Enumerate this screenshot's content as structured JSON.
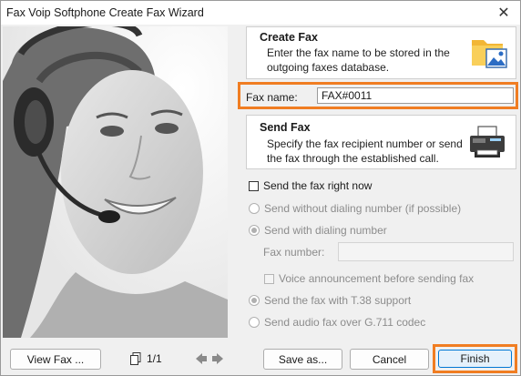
{
  "window": {
    "title": "Fax Voip Softphone Create Fax Wizard"
  },
  "create_fax": {
    "title": "Create Fax",
    "description": "Enter the fax name to be stored in the outgoing faxes database.",
    "icon": "folder-picture-icon"
  },
  "fax_name": {
    "label": "Fax name:",
    "value": "FAX#0011"
  },
  "send_fax": {
    "title": "Send Fax",
    "description": "Specify the fax recipient number or send the fax through the established call.",
    "icon": "fax-machine-icon"
  },
  "options": {
    "send_now": {
      "label": "Send the fax right now",
      "checked": false
    },
    "without_dialing": {
      "label": "Send without dialing number (if possible)",
      "selected": false,
      "enabled": false
    },
    "with_dialing": {
      "label": "Send with dialing number",
      "selected": true,
      "enabled": false
    },
    "fax_number": {
      "label": "Fax number:",
      "value": ""
    },
    "voice_announcement": {
      "label": "Voice announcement before sending fax",
      "checked": false,
      "enabled": false
    },
    "t38": {
      "label": "Send the fax with T.38 support",
      "selected": true,
      "enabled": false
    },
    "g711": {
      "label": "Send audio fax over G.711 codec",
      "selected": false,
      "enabled": false
    }
  },
  "buttons": {
    "view_fax": "View Fax ...",
    "save_as": "Save as...",
    "cancel": "Cancel",
    "finish": "Finish"
  },
  "pager": {
    "text": "1/1"
  },
  "colors": {
    "highlight": "#f07d22",
    "accent": "#0078d4"
  }
}
